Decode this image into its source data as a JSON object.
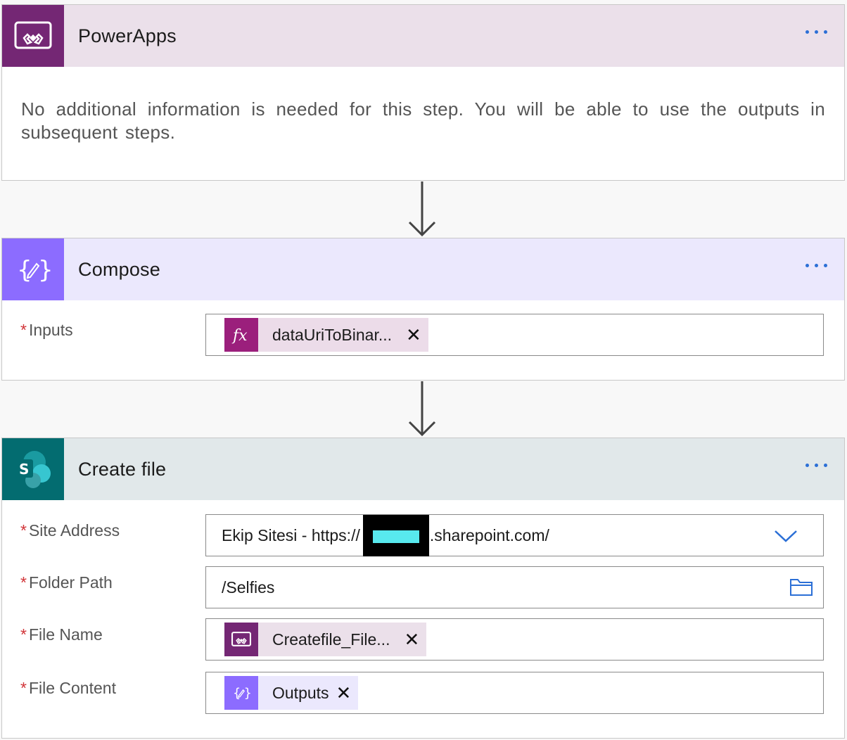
{
  "steps": {
    "powerapps": {
      "title": "PowerApps",
      "icon": "powerapps-icon",
      "color": "#742774",
      "header_bg": "#ebe0ea",
      "info": "No additional information is needed for this step. You will be able to use the outputs in subsequent steps."
    },
    "compose": {
      "title": "Compose",
      "icon": "compose-icon",
      "color": "#8c6cff",
      "header_bg": "#ebe8fd",
      "inputs_label": "Inputs",
      "inputs_token": {
        "label": "dataUriToBinar...",
        "icon": "fx-icon",
        "icon_color": "#9b1f7c",
        "bg": "#ecdce9"
      }
    },
    "create_file": {
      "title": "Create file",
      "icon": "sharepoint-icon",
      "color": "#036c70",
      "header_bg": "#e1e8ea",
      "site_address": {
        "label": "Site Address",
        "prefix": "Ekip Sitesi - https://",
        "suffix": ".sharepoint.com/"
      },
      "folder_path": {
        "label": "Folder Path",
        "value": "/Selfies"
      },
      "file_name": {
        "label": "File Name",
        "token": "Createfile_File...",
        "icon": "powerapps-icon"
      },
      "file_content": {
        "label": "File Content",
        "token": "Outputs",
        "icon": "compose-icon"
      }
    }
  },
  "required_marker": "*",
  "remove_glyph": "✕",
  "more_icon": "more-options-icon",
  "accent": "#2b6fd6"
}
